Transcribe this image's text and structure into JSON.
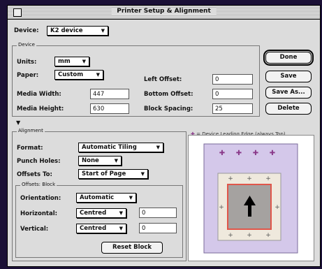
{
  "window": {
    "title": "Printer Setup & Alignment"
  },
  "device_row": {
    "label": "Device:",
    "value": "K2 device"
  },
  "device_group": {
    "title": "Device",
    "units_label": "Units:",
    "units_value": "mm",
    "paper_label": "Paper:",
    "paper_value": "Custom",
    "media_width_label": "Media Width:",
    "media_width_value": "447",
    "media_height_label": "Media Height:",
    "media_height_value": "630",
    "left_offset_label": "Left Offset:",
    "left_offset_value": "0",
    "bottom_offset_label": "Bottom Offset:",
    "bottom_offset_value": "0",
    "block_spacing_label": "Block Spacing:",
    "block_spacing_value": "25"
  },
  "buttons": {
    "done": "Done",
    "save": "Save",
    "save_as": "Save As...",
    "delete": "Delete"
  },
  "alignment_group": {
    "title": "Alignment",
    "format_label": "Format:",
    "format_value": "Automatic Tiling",
    "punch_label": "Punch Holes:",
    "punch_value": "None",
    "offsets_label": "Offsets To:",
    "offsets_value": "Start of Page"
  },
  "offsets_group": {
    "title": "Offsets: Block",
    "orientation_label": "Orientation:",
    "orientation_value": "Automatic",
    "horizontal_label": "Horizontal:",
    "horizontal_value": "Centred",
    "horizontal_amount": "0",
    "vertical_label": "Vertical:",
    "vertical_value": "Centred",
    "vertical_amount": "0",
    "reset_button": "Reset Block"
  },
  "preview": {
    "legend": "= Device Leading Edge (always Top)",
    "page_color": "#d4c8ea",
    "block_border_color": "#e0564a",
    "block_fill_color": "#a5a2a0",
    "marker_color": "#8a3a8a",
    "arrow_icon": "up-arrow-icon"
  }
}
